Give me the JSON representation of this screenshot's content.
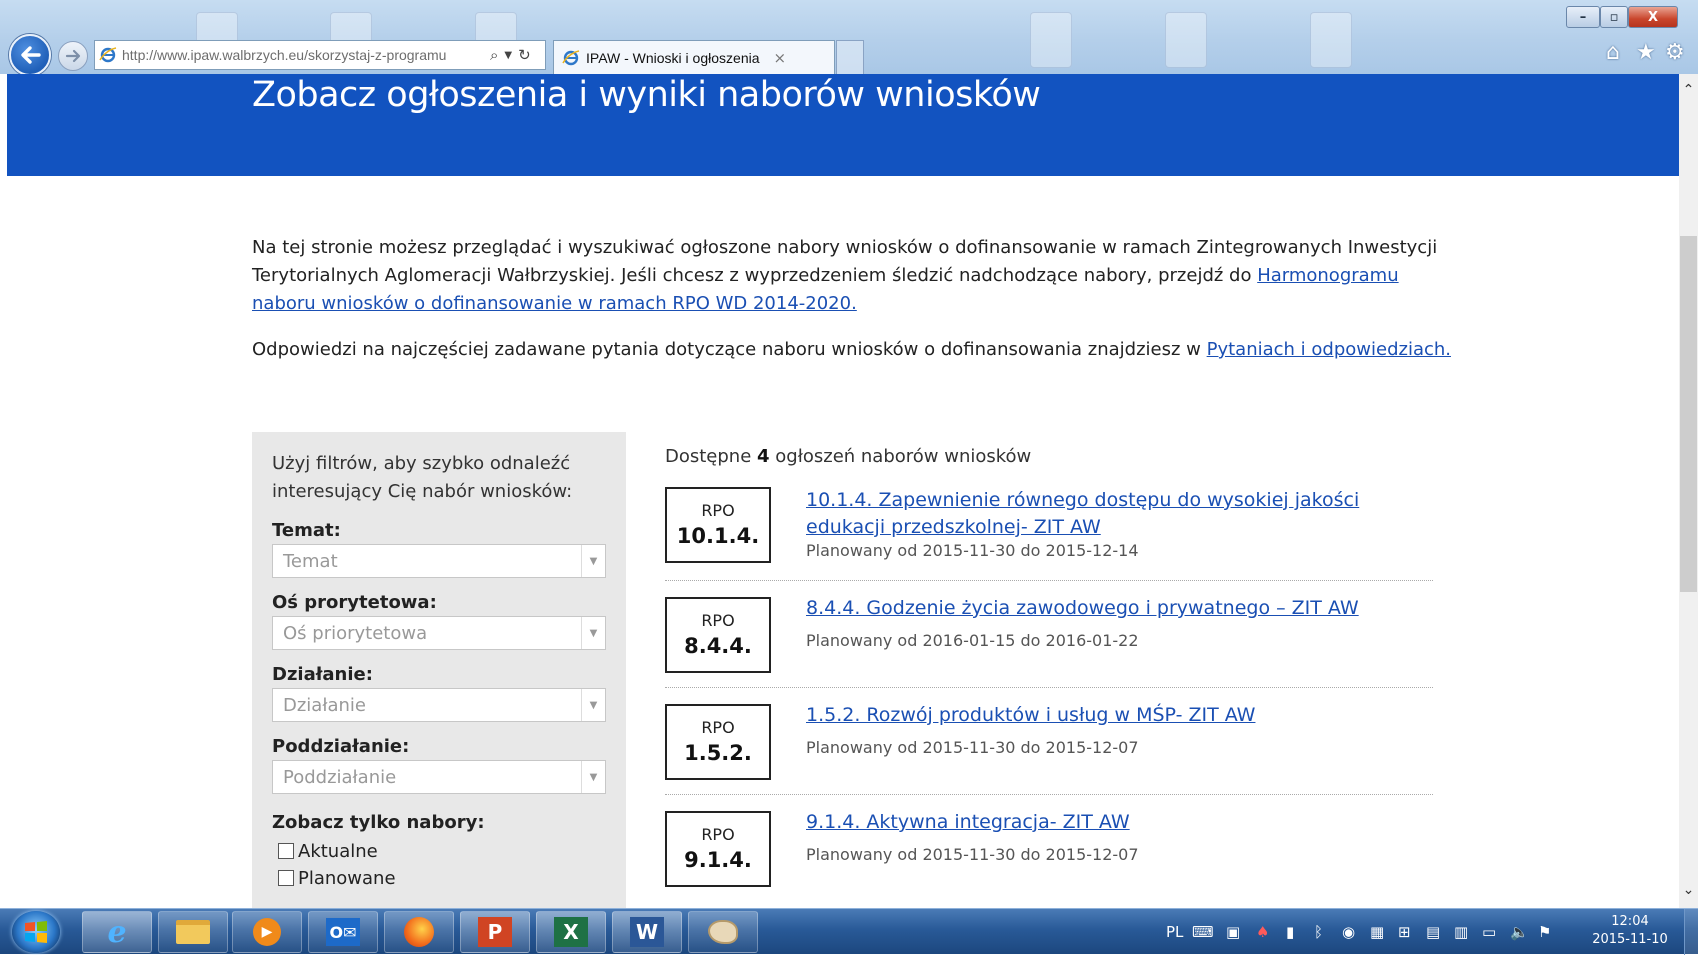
{
  "browser": {
    "url": "http://www.ipaw.walbrzych.eu/skorzystaj-z-programu",
    "tab_title": "IPAW - Wnioski i ogłoszenia",
    "tab_close": "×",
    "window_buttons": {
      "minimize": "–",
      "maximize": "▫",
      "close": "X"
    }
  },
  "page": {
    "hero_title": "Zobacz ogłoszenia i wyniki naborów wniosków",
    "intro": {
      "p1_text": "Na tej stronie możesz przeglądać i wyszukiwać ogłoszone nabory wniosków o dofinansowanie w ramach Zintegrowanych Inwestycji Terytorialnych Aglomeracji Wałbrzyskiej. Jeśli chcesz z wyprzedzeniem śledzić nadchodzące nabory, przejdź do ",
      "p1_link": "Harmonogramu naboru wniosków o dofinansowanie w ramach RPO WD 2014-2020.",
      "p2_text": "Odpowiedzi na najczęściej zadawane pytania dotyczące naboru wniosków o dofinansowania znajdziesz w ",
      "p2_link": "Pytaniach i odpowiedziach."
    },
    "filters": {
      "intro": "Użyj filtrów, aby szybko odnaleźć interesujący Cię nabór wniosków:",
      "temat_label": "Temat:",
      "temat_placeholder": "Temat",
      "os_label": "Oś prorytetowa:",
      "os_placeholder": "Oś priorytetowa",
      "dzialanie_label": "Działanie:",
      "dzialanie_placeholder": "Działanie",
      "poddzialanie_label": "Poddziałanie:",
      "poddzialanie_placeholder": "Poddziałanie",
      "zobacz_label": "Zobacz tylko nabory:",
      "checkbox_aktualne": "Aktualne",
      "checkbox_planowane": "Planowane"
    },
    "results": {
      "count_prefix": "Dostępne",
      "count": "4",
      "count_suffix": "ogłoszeń naborów wniosków",
      "items": [
        {
          "type": "RPO",
          "number": "10.1.4.",
          "title": "10.1.4. Zapewnienie równego dostępu do wysokiej jakości edukacji przedszkolnej- ZIT AW",
          "date": "Planowany od 2015-11-30 do 2015-12-14"
        },
        {
          "type": "RPO",
          "number": "8.4.4.",
          "title": "8.4.4. Godzenie życia zawodowego i prywatnego – ZIT AW",
          "date": "Planowany od 2016-01-15 do 2016-01-22"
        },
        {
          "type": "RPO",
          "number": "1.5.2.",
          "title": "1.5.2. Rozwój produktów i usług w MŚP- ZIT AW",
          "date": "Planowany od 2015-11-30 do 2015-12-07"
        },
        {
          "type": "RPO",
          "number": "9.1.4.",
          "title": "9.1.4. Aktywna integracja- ZIT AW",
          "date": "Planowany od 2015-11-30 do 2015-12-07"
        }
      ]
    }
  },
  "taskbar": {
    "language": "PL",
    "time": "12:04",
    "date": "2015-11-10",
    "apps": [
      "internet-explorer",
      "file-explorer",
      "media-player",
      "outlook",
      "firefox",
      "powerpoint",
      "excel",
      "word",
      "paint"
    ]
  },
  "colors": {
    "hero": "#1253c0",
    "link": "#1a4fb3",
    "filter_panel": "#e8e8e8"
  }
}
